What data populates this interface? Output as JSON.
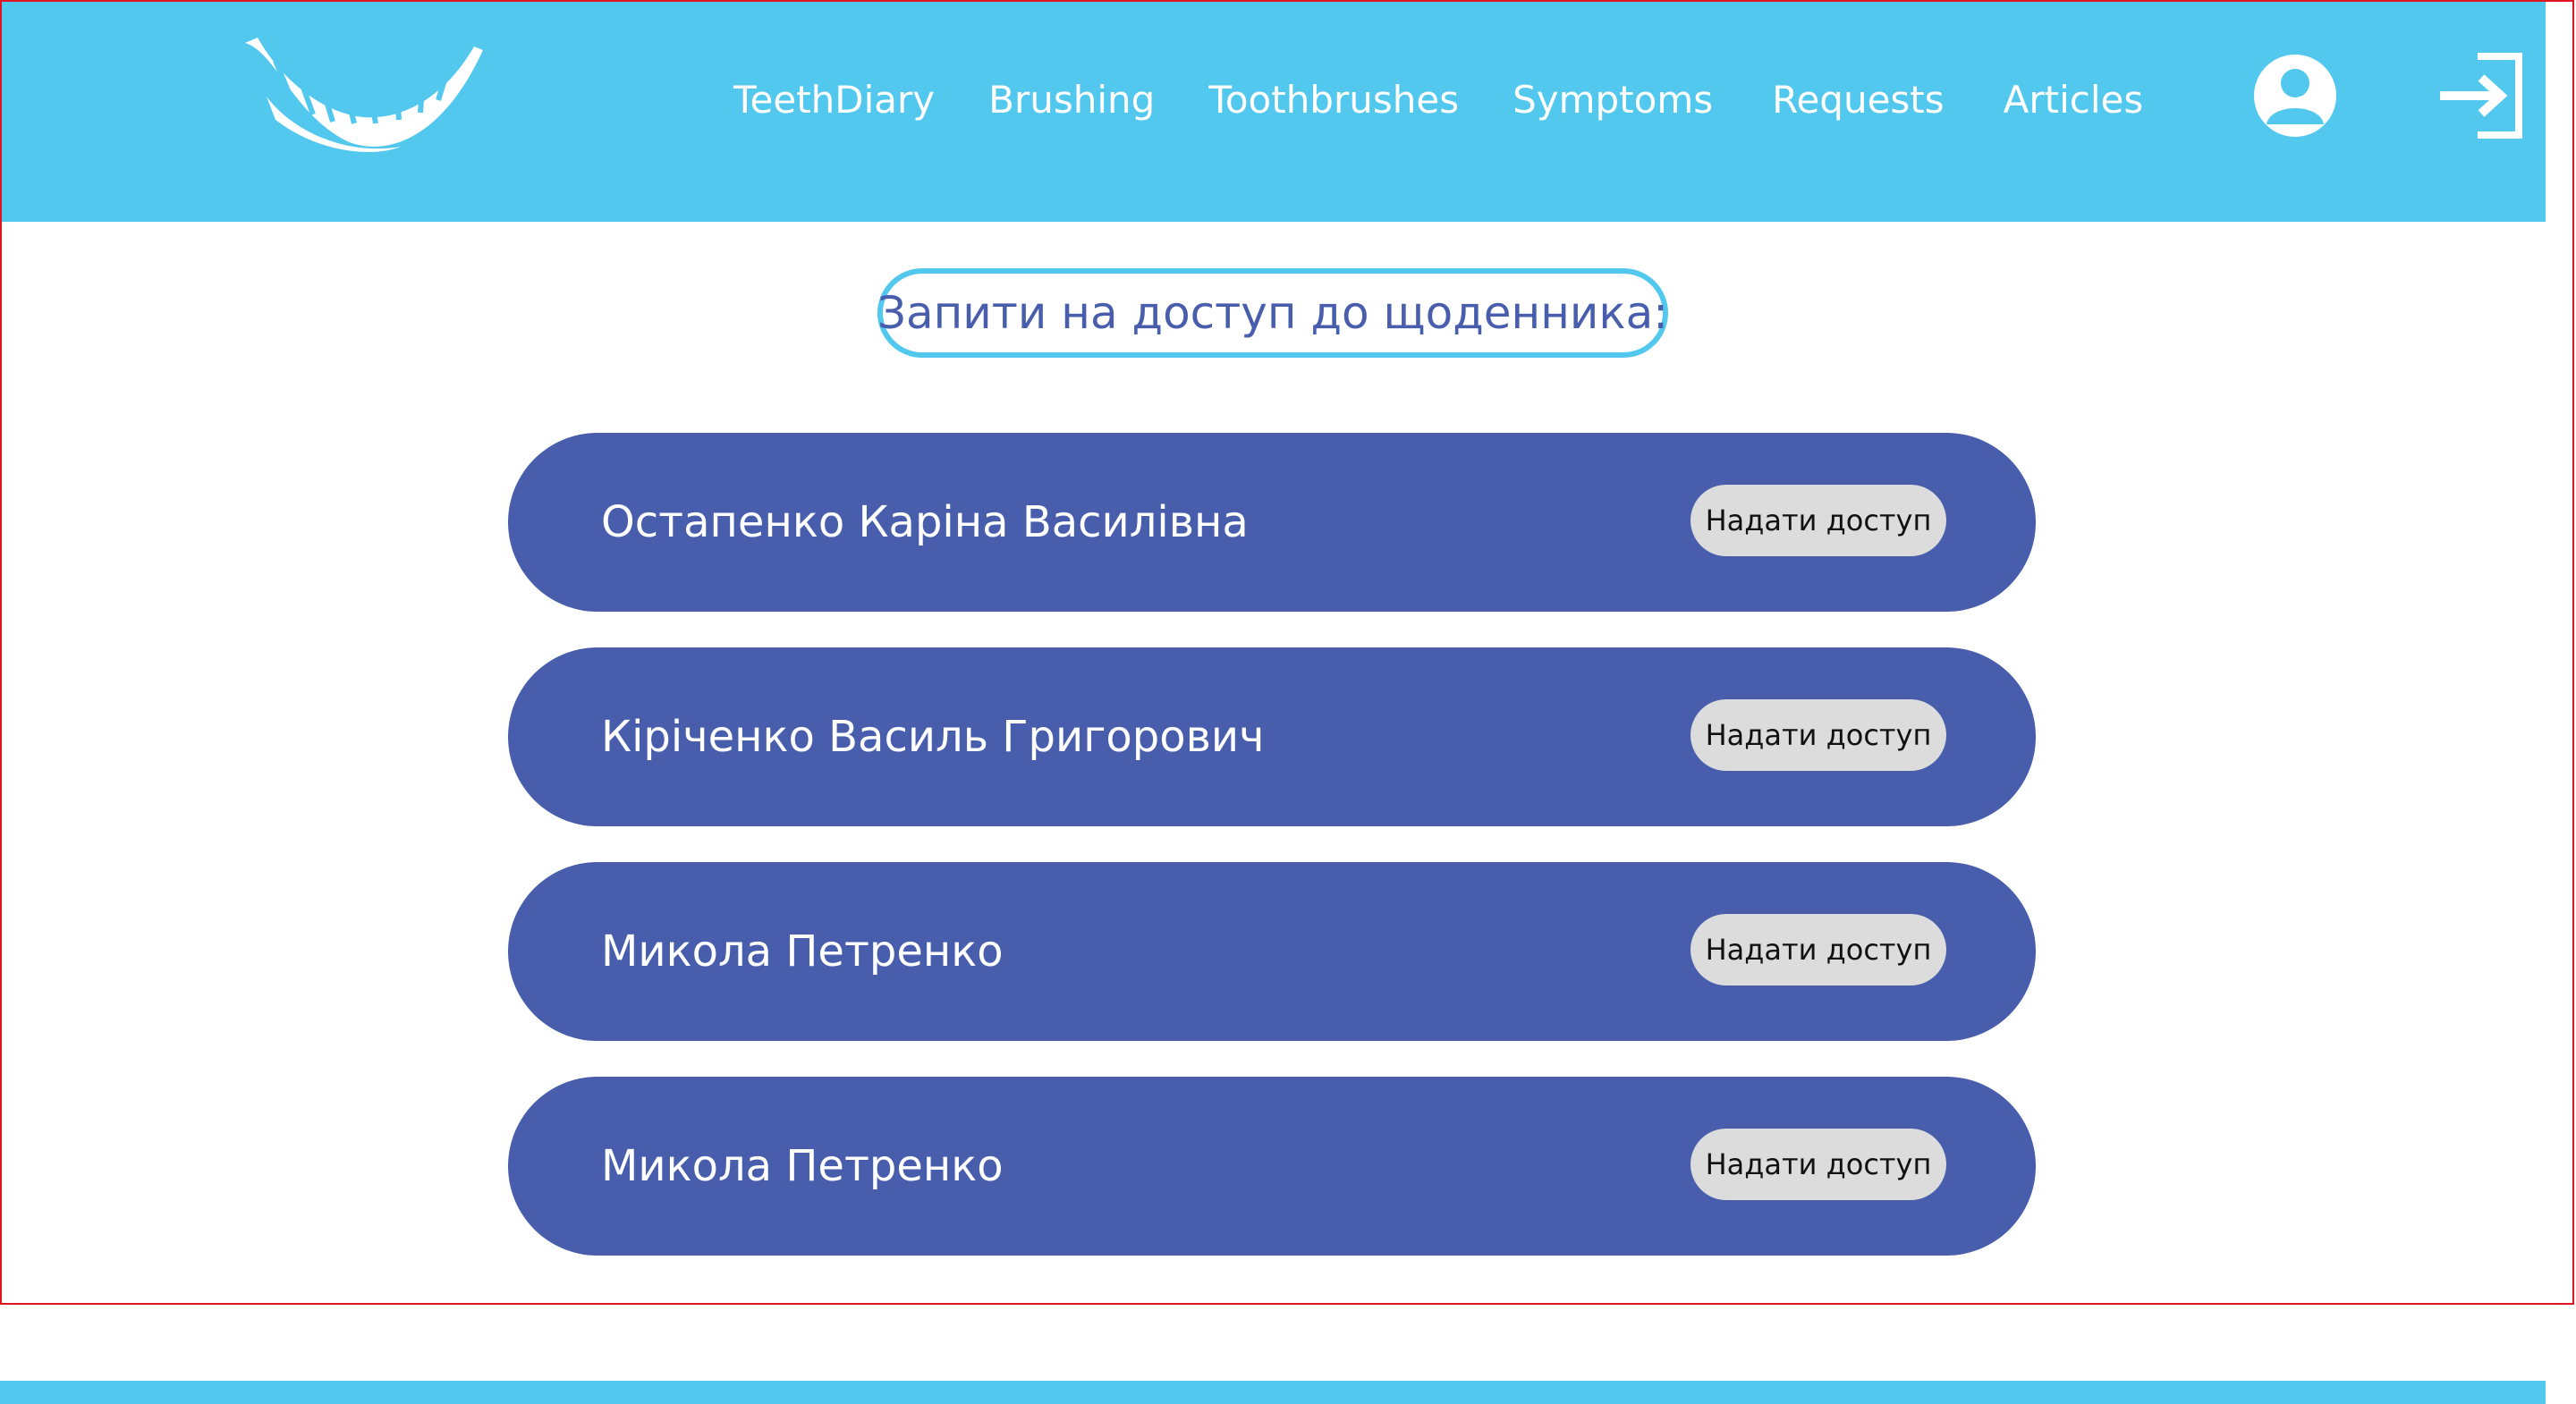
{
  "colors": {
    "header_bg": "#53c8ee",
    "accent_blue": "#485eac",
    "button_bg": "#dcdcdc"
  },
  "header": {
    "logo_icon": "teeth-smile-logo-icon",
    "nav": [
      {
        "label": "TeethDiary"
      },
      {
        "label": "Brushing"
      },
      {
        "label": "Toothbrushes"
      },
      {
        "label": "Symptoms"
      },
      {
        "label": "Requests"
      },
      {
        "label": "Articles"
      }
    ],
    "profile_icon": "user-profile-icon",
    "logout_icon": "logout-icon"
  },
  "main": {
    "title": "Запити на доступ до щоденника:",
    "requests": [
      {
        "name": "Остапенко Каріна Василівна",
        "button_label": "Надати доступ"
      },
      {
        "name": "Кіріченко Василь Григорович",
        "button_label": "Надати доступ"
      },
      {
        "name": "Микола Петренко",
        "button_label": "Надати доступ"
      },
      {
        "name": "Микола Петренко",
        "button_label": "Надати доступ"
      }
    ]
  }
}
